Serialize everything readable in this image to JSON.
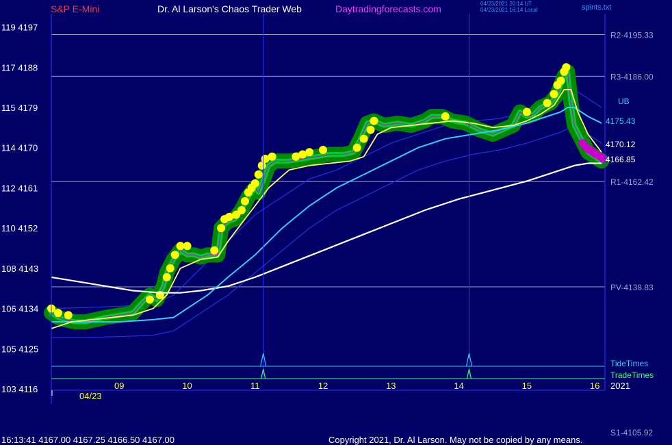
{
  "header": {
    "instrument": "S&P E-Mini",
    "brand": "Dr. Al Larson's Chaos Trader Web",
    "site": "Daytradingforecasts.com",
    "stamp_line1": "04/23/2021 20:14 UT",
    "stamp_line2": "04/23/2021 16:14 Local",
    "file": "spints.txt"
  },
  "footer": {
    "quote": "16:13:41  4167.00 4167.25 4166.50 4167.00",
    "copyright": "Copyright 2021, Dr. Al Larson. May not be copied by any means."
  },
  "colors": {
    "background": "#000066",
    "axis": "#3333ff",
    "grid": "#a0a0c8",
    "price": "#00cc33",
    "band": "#008800",
    "dots": "#ffff00",
    "fast_avg": "#ffff66",
    "mid_avg": "#33ccff",
    "slow_avg": "#ffffff",
    "outer_band": "#2233dd",
    "tide": "#33ccff",
    "trade": "#33ff66",
    "magenta": "#cc00cc"
  },
  "chart_data": {
    "type": "line",
    "title": "S&P E-Mini",
    "x_label_date": "04/23",
    "x_label_year": "2021",
    "x_ticks": [
      9,
      10,
      11,
      12,
      13,
      14,
      15,
      16
    ],
    "xlim": [
      8.0,
      16.15
    ],
    "ylim": [
      4116,
      4200
    ],
    "y_ticks": [
      {
        "price": 4197,
        "label": "119  4197"
      },
      {
        "price": 4188,
        "label": "117  4188"
      },
      {
        "price": 4179,
        "label": "115  4179"
      },
      {
        "price": 4170,
        "label": "114  4170"
      },
      {
        "price": 4161,
        "label": "112  4161"
      },
      {
        "price": 4152,
        "label": "110  4152"
      },
      {
        "price": 4143,
        "label": "108  4143"
      },
      {
        "price": 4134,
        "label": "106  4134"
      },
      {
        "price": 4125,
        "label": "105  4125"
      },
      {
        "price": 4116,
        "label": "103  4116"
      }
    ],
    "levels": [
      {
        "name": "R2",
        "value": 4195.33,
        "label": "R2-4195.33"
      },
      {
        "name": "R3",
        "value": 4186.0,
        "label": "R3-4186.00"
      },
      {
        "name": "R1",
        "value": 4162.42,
        "label": "R1-4162.42"
      },
      {
        "name": "PV",
        "value": 4138.83,
        "label": "PV-4138.83"
      },
      {
        "name": "S1",
        "value": 4105.92,
        "label": "S1-4105.92"
      }
    ],
    "right_labels": {
      "ub": "UB",
      "mid": "4175.43",
      "fast": "4170.12",
      "slow": "4166.85",
      "tide": "TideTimes",
      "trade": "TradeTimes"
    },
    "event_times": [
      11.12,
      14.15
    ],
    "series": [
      {
        "key": "price",
        "x": [
          8.0,
          8.1,
          8.2,
          8.35,
          8.5,
          8.65,
          8.8,
          9.0,
          9.2,
          9.35,
          9.45,
          9.55,
          9.65,
          9.7,
          9.8,
          9.9,
          10.0,
          10.1,
          10.2,
          10.3,
          10.45,
          10.5,
          10.6,
          10.7,
          10.8,
          10.9,
          11.0,
          11.05,
          11.1,
          11.2,
          11.3,
          11.5,
          11.7,
          11.9,
          12.1,
          12.3,
          12.45,
          12.55,
          12.65,
          12.75,
          12.9,
          13.1,
          13.3,
          13.5,
          13.6,
          13.75,
          13.9,
          14.1,
          14.3,
          14.5,
          14.65,
          14.8,
          14.9,
          15.0,
          15.1,
          15.2,
          15.35,
          15.45,
          15.5,
          15.55,
          15.6,
          15.65,
          15.7,
          15.8,
          15.9,
          16.0,
          16.1
        ],
        "y": [
          4133,
          4132,
          4131.5,
          4131,
          4131,
          4131.5,
          4132,
          4132.5,
          4133,
          4135.5,
          4137,
          4136,
          4139,
          4142,
          4145,
          4147,
          4146,
          4146,
          4145.5,
          4146,
          4146,
          4152,
          4153.5,
          4154,
          4156,
          4159,
          4161,
          4160,
          4162,
          4166,
          4167,
          4167,
          4167.5,
          4168,
          4168.5,
          4168.5,
          4169,
          4172,
          4175.5,
          4176,
          4175,
          4175.5,
          4175,
          4176,
          4177,
          4177,
          4176,
          4175.5,
          4174,
          4173,
          4174,
          4175,
          4178,
          4177,
          4177.5,
          4179,
          4180,
          4182,
          4184,
          4186,
          4187,
          4180,
          4175,
          4172,
          4169,
          4168,
          4167
        ]
      },
      {
        "key": "fast_avg",
        "x": [
          8.0,
          8.3,
          8.6,
          8.9,
          9.2,
          9.5,
          9.7,
          9.9,
          10.2,
          10.45,
          10.6,
          10.8,
          11.0,
          11.2,
          11.5,
          11.8,
          12.1,
          12.4,
          12.6,
          12.8,
          13.0,
          13.3,
          13.6,
          13.9,
          14.2,
          14.5,
          14.8,
          15.0,
          15.2,
          15.4,
          15.55,
          15.65,
          15.75,
          15.9,
          16.1
        ],
        "y": [
          4129.5,
          4131,
          4131.5,
          4132,
          4132.5,
          4134,
          4137,
          4143,
          4145,
          4145.5,
          4149,
          4153,
          4157,
          4161,
          4165,
          4166,
          4166.5,
          4167,
          4168,
          4173,
          4174.5,
          4175,
          4175.5,
          4176,
          4175.5,
          4174.5,
          4175,
          4176,
          4177.5,
          4179.5,
          4183,
          4183,
          4178,
          4173,
          4169
        ]
      },
      {
        "key": "mid_avg",
        "x": [
          8.0,
          8.5,
          9.0,
          9.5,
          9.8,
          10.0,
          10.3,
          10.6,
          11.0,
          11.4,
          11.8,
          12.2,
          12.6,
          13.0,
          13.4,
          13.8,
          14.2,
          14.6,
          15.0,
          15.3,
          15.5,
          15.6,
          15.7,
          15.9,
          16.1
        ],
        "y": [
          4131,
          4131,
          4131,
          4131.5,
          4132,
          4134,
          4137,
          4141,
          4146,
          4152,
          4157,
          4161,
          4164,
          4167,
          4170,
          4172,
          4173,
          4174,
          4175.5,
          4177,
          4178,
          4179,
          4179,
          4177,
          4175.5
        ]
      },
      {
        "key": "upper_band",
        "x": [
          8.0,
          8.5,
          9.0,
          9.5,
          9.8,
          10.2,
          10.6,
          11.0,
          11.4,
          11.8,
          12.2,
          12.6,
          13.0,
          13.4,
          13.8,
          14.2,
          14.6,
          15.0,
          15.3,
          15.5,
          15.7,
          15.9,
          16.1
        ],
        "y": [
          4134,
          4134.2,
          4134.5,
          4135,
          4137,
          4143,
          4149,
          4155,
          4159,
          4163,
          4165,
          4168,
          4171,
          4173,
          4175,
          4176,
          4176.5,
          4178,
          4181,
          4182,
          4183,
          4181,
          4179
        ]
      },
      {
        "key": "lower_band",
        "x": [
          8.0,
          8.5,
          9.0,
          9.5,
          9.8,
          10.2,
          10.6,
          11.0,
          11.4,
          11.8,
          12.2,
          12.6,
          13.0,
          13.4,
          13.8,
          14.2,
          14.6,
          15.0,
          15.3,
          15.5,
          15.7,
          15.9,
          16.1
        ],
        "y": [
          4127.5,
          4127.5,
          4127.7,
          4128,
          4129,
          4133,
          4137,
          4142,
          4147,
          4152,
          4156,
          4159,
          4162,
          4165,
          4167,
          4168.5,
          4169.5,
          4171,
          4172.5,
          4173.5,
          4175,
          4173,
          4171
        ]
      },
      {
        "key": "slow_avg",
        "x": [
          8.0,
          8.4,
          8.8,
          9.2,
          9.6,
          9.9,
          10.2,
          10.6,
          11.0,
          11.5,
          12.0,
          12.5,
          13.0,
          13.5,
          14.0,
          14.5,
          15.0,
          15.4,
          15.7,
          15.9,
          16.1
        ],
        "y": [
          4141,
          4140,
          4139,
          4138,
          4137.5,
          4137.5,
          4138,
          4139,
          4141,
          4144,
          4147,
          4150,
          4153,
          4156,
          4158.5,
          4160.5,
          4162.5,
          4164.5,
          4166,
          4166.5,
          4166.5
        ]
      }
    ],
    "dots": [
      {
        "x": 8.0,
        "y": 4134
      },
      {
        "x": 8.1,
        "y": 4133
      },
      {
        "x": 8.25,
        "y": 4132.5
      },
      {
        "x": 9.45,
        "y": 4136
      },
      {
        "x": 9.6,
        "y": 4137
      },
      {
        "x": 9.7,
        "y": 4141
      },
      {
        "x": 9.75,
        "y": 4143
      },
      {
        "x": 9.82,
        "y": 4146
      },
      {
        "x": 9.9,
        "y": 4148
      },
      {
        "x": 10.0,
        "y": 4148
      },
      {
        "x": 10.4,
        "y": 4147
      },
      {
        "x": 10.5,
        "y": 4152
      },
      {
        "x": 10.55,
        "y": 4154
      },
      {
        "x": 10.62,
        "y": 4154.5
      },
      {
        "x": 10.72,
        "y": 4155
      },
      {
        "x": 10.8,
        "y": 4156
      },
      {
        "x": 10.85,
        "y": 4158
      },
      {
        "x": 10.9,
        "y": 4160
      },
      {
        "x": 10.95,
        "y": 4161
      },
      {
        "x": 11.0,
        "y": 4162
      },
      {
        "x": 11.05,
        "y": 4164
      },
      {
        "x": 11.1,
        "y": 4166
      },
      {
        "x": 11.15,
        "y": 4167.5
      },
      {
        "x": 11.25,
        "y": 4168
      },
      {
        "x": 11.6,
        "y": 4168
      },
      {
        "x": 11.7,
        "y": 4168.5
      },
      {
        "x": 11.8,
        "y": 4169
      },
      {
        "x": 12.0,
        "y": 4169.5
      },
      {
        "x": 12.5,
        "y": 4170
      },
      {
        "x": 12.6,
        "y": 4172
      },
      {
        "x": 12.7,
        "y": 4174
      },
      {
        "x": 12.75,
        "y": 4176
      },
      {
        "x": 13.8,
        "y": 4177
      },
      {
        "x": 15.0,
        "y": 4178
      },
      {
        "x": 15.3,
        "y": 4180
      },
      {
        "x": 15.4,
        "y": 4182
      },
      {
        "x": 15.45,
        "y": 4184
      },
      {
        "x": 15.5,
        "y": 4185
      },
      {
        "x": 15.55,
        "y": 4187
      },
      {
        "x": 15.58,
        "y": 4188
      }
    ],
    "magenta_dots": [
      {
        "x": 15.82,
        "y": 4171
      },
      {
        "x": 15.88,
        "y": 4170
      },
      {
        "x": 15.92,
        "y": 4169.5
      },
      {
        "x": 15.97,
        "y": 4169
      },
      {
        "x": 16.02,
        "y": 4168.5
      },
      {
        "x": 16.08,
        "y": 4168
      },
      {
        "x": 16.12,
        "y": 4167.5
      }
    ]
  }
}
